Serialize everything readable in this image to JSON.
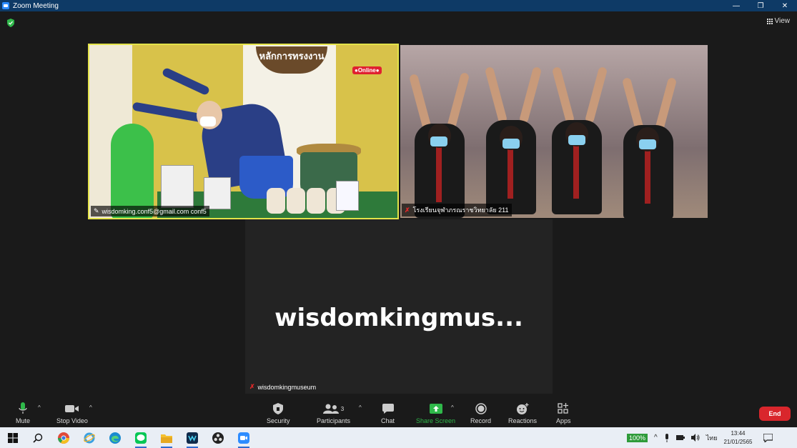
{
  "window": {
    "title": "Zoom Meeting",
    "minimize_glyph": "—",
    "restore_glyph": "❐",
    "close_glyph": "✕"
  },
  "top_bar": {
    "view_label": "View"
  },
  "tiles": [
    {
      "name": "wisdomking.conf5@gmail.com conf5",
      "poster_title": "หลักการทรงงาน",
      "online_badge": "●Online●"
    },
    {
      "name": "โรงเรียนจุฬาภรณราชวิทยาลัย 211"
    },
    {
      "display_name": "wisdomkingmus...",
      "name": "wisdomkingmuseum"
    }
  ],
  "toolbar": {
    "mute_label": "Mute",
    "stop_video_label": "Stop Video",
    "security_label": "Security",
    "participants_label": "Participants",
    "participants_count": "3",
    "chat_label": "Chat",
    "share_screen_label": "Share Screen",
    "record_label": "Record",
    "reactions_label": "Reactions",
    "apps_label": "Apps",
    "end_label": "End",
    "caret_glyph": "^"
  },
  "taskbar": {
    "zoom_percent": "100%",
    "language": "ไทย",
    "time": "13:44",
    "date": "21/01/2565"
  },
  "colors": {
    "accent_green": "#2fb84a",
    "end_red": "#d9262c",
    "active_speaker_border": "#e3e34a"
  }
}
